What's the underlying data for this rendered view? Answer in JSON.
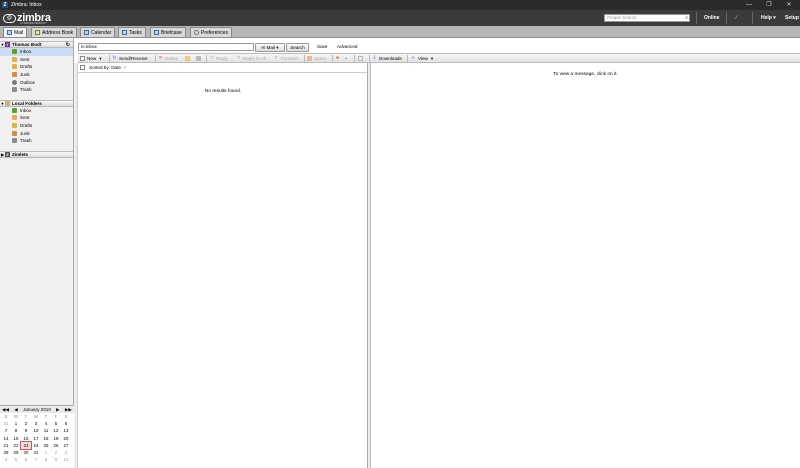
{
  "window": {
    "title": "Zimbra: Inbox",
    "controls": [
      "—",
      "❐",
      "✕"
    ]
  },
  "appbar": {
    "logo_text": "zimbra",
    "logo_tagline": "A VMWARE PRODUCT",
    "people_search_placeholder": "People Search",
    "status": "Online",
    "help_label": "Help",
    "setup_label": "Setup"
  },
  "app_tabs": [
    {
      "label": "Mail",
      "icon": "mail-icon"
    },
    {
      "label": "Address Book",
      "icon": "address-book-icon"
    },
    {
      "label": "Calendar",
      "icon": "calendar-icon"
    },
    {
      "label": "Tasks",
      "icon": "tasks-icon"
    },
    {
      "label": "Briefcase",
      "icon": "briefcase-icon"
    },
    {
      "label": "Preferences",
      "icon": "preferences-icon"
    }
  ],
  "accounts": [
    {
      "name": "Thomas Bodt",
      "folders": [
        "Inbox",
        "Sent",
        "Drafts",
        "Junk",
        "Outbox",
        "Trash"
      ]
    },
    {
      "name": "Local Folders",
      "folders": [
        "Inbox",
        "Sent",
        "Drafts",
        "Junk",
        "Trash"
      ]
    }
  ],
  "zimlets_label": "Zimlets",
  "search": {
    "value": "in:inbox",
    "type_label": "Mail",
    "search_label": "Search",
    "save_label": "Save",
    "advanced_label": "Advanced"
  },
  "toolbar": {
    "new": "New",
    "send_receive": "Send/Receive",
    "delete": "Delete",
    "reply": "Reply",
    "reply_all": "Reply to All",
    "forward": "Forward",
    "spam": "Spam",
    "downloads": "Downloads",
    "view": "View"
  },
  "list": {
    "sorted_by": "Sorted by: Date",
    "empty_message": "No results found."
  },
  "reading_pane": {
    "message": "To view a message, click on it."
  },
  "mini_calendar": {
    "month_label": "January 2010",
    "weekdays": [
      "S",
      "M",
      "T",
      "W",
      "T",
      "F",
      "S"
    ],
    "weeks": [
      [
        "31",
        "1",
        "2",
        "3",
        "4",
        "5",
        "6"
      ],
      [
        "7",
        "8",
        "9",
        "10",
        "11",
        "12",
        "13"
      ],
      [
        "14",
        "15",
        "16",
        "17",
        "18",
        "19",
        "20"
      ],
      [
        "21",
        "22",
        "23",
        "24",
        "25",
        "26",
        "27"
      ],
      [
        "28",
        "29",
        "30",
        "31",
        "1",
        "2",
        "3"
      ],
      [
        "4",
        "5",
        "6",
        "7",
        "8",
        "9",
        "10"
      ]
    ],
    "today": "23"
  }
}
